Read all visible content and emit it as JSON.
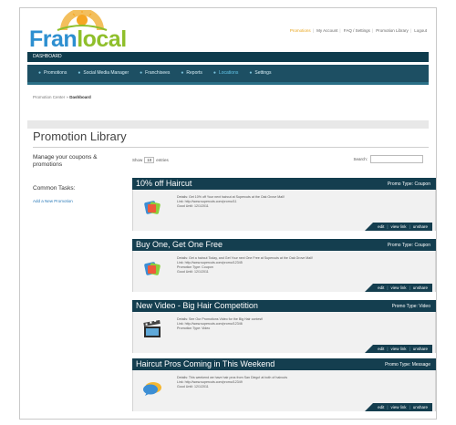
{
  "logo": {
    "part1": "Fran",
    "part2": "local"
  },
  "toplinks": [
    "Promotions",
    "My Account",
    "FAQ / Settings",
    "Promotion Library",
    "Logout"
  ],
  "dashbar": {
    "label": "DASHBOARD"
  },
  "nav": {
    "items": [
      {
        "label": "Promotions"
      },
      {
        "label": "Social Media Manager"
      },
      {
        "label": "Franchisees"
      },
      {
        "label": "Reports"
      },
      {
        "label": "Locations",
        "active": true
      },
      {
        "label": "Settings"
      }
    ]
  },
  "breadcrumb": {
    "prefix": "Promotion Center » ",
    "current": "Dashboard"
  },
  "page": {
    "title": "Promotion Library"
  },
  "sidebar": {
    "manage_text": "Manage your coupons & promotions",
    "common_tasks": "Common Tasks:",
    "add_link": "Add a New Promotion"
  },
  "table_controls": {
    "show_label": "Show",
    "show_value": "10",
    "entries_label": "entries",
    "search_label": "Search:"
  },
  "promotions": [
    {
      "title": "10% off Haircut",
      "type": "Promo Type: Coupon",
      "icon": "coupon-icon",
      "detail_lines": [
        "Details: Get 10% off Your next haircut at Supercuts at the Oak Grove Mall!",
        "Link: http://www.supercuts.com/promo/11",
        "Good Until: 12/1/2011"
      ],
      "actions": [
        "edit",
        "view link",
        "unshare"
      ]
    },
    {
      "title": "Buy One, Get One Free",
      "type": "Promo Type: Coupon",
      "icon": "coupon-icon",
      "detail_lines": [
        "Details: Get a haircut Today, and Get Your next One Free at Supercuts at the Oak Grove Mall!",
        "Link: http://www.supercuts.com/promo/12345",
        "Promotion Type: Coupon",
        "Good Until: 12/1/2011"
      ],
      "actions": [
        "edit",
        "view link",
        "unshare"
      ]
    },
    {
      "title": "New Video - Big Hair Competition",
      "type": "Promo Type: Video",
      "icon": "video-icon",
      "detail_lines": [
        "Details: See Our Promotions Video for the Big Hair contest!",
        "Link: http://www.supercuts.com/promo/12346",
        "Promotion Type: Video"
      ],
      "actions": [
        "edit",
        "view link",
        "unshare"
      ]
    },
    {
      "title": "Haircut Pros Coming in This Weekend",
      "type": "Promo Type: Message",
      "icon": "message-icon",
      "detail_lines": [
        "Details: This weekend we have hair pros from San Diego! at both of haircuts",
        "Link: http://www.supercuts.com/promo/12349",
        "Good Until: 12/1/2011"
      ],
      "actions": [
        "edit",
        "view link",
        "unshare"
      ]
    }
  ],
  "colors": {
    "accent_blue": "#2d8fd0",
    "accent_green": "#8fbf2b",
    "header_dark": "#143e4f"
  }
}
